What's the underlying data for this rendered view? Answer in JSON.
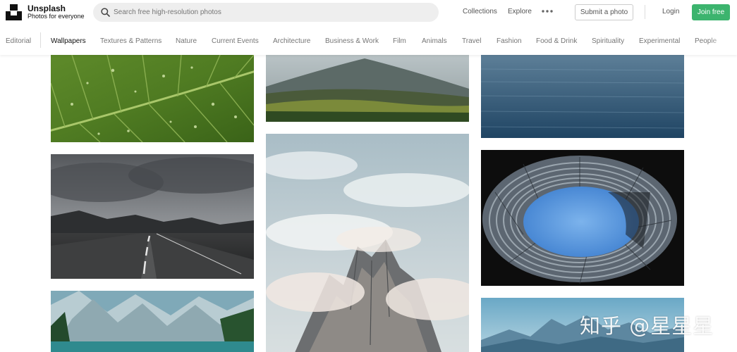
{
  "brand": {
    "name": "Unsplash",
    "tagline": "Photos for everyone"
  },
  "search": {
    "placeholder": "Search free high-resolution photos"
  },
  "nav": {
    "collections": "Collections",
    "explore": "Explore",
    "more_icon": "ellipsis-icon"
  },
  "actions": {
    "submit": "Submit a photo",
    "login": "Login",
    "join": "Join free"
  },
  "colors": {
    "accent": "#3cb46e"
  },
  "categories": [
    {
      "label": "Editorial"
    },
    {
      "label": "Wallpapers"
    },
    {
      "label": "Textures & Patterns"
    },
    {
      "label": "Nature"
    },
    {
      "label": "Current Events"
    },
    {
      "label": "Architecture"
    },
    {
      "label": "Business & Work"
    },
    {
      "label": "Film"
    },
    {
      "label": "Animals"
    },
    {
      "label": "Travel"
    },
    {
      "label": "Fashion"
    },
    {
      "label": "Food & Drink"
    },
    {
      "label": "Spirituality"
    },
    {
      "label": "Experimental"
    },
    {
      "label": "People"
    }
  ],
  "active_category": "Wallpapers",
  "photos": [
    {
      "subject": "green leaf with water droplets"
    },
    {
      "subject": "volcano mountain over green valley"
    },
    {
      "subject": "calm deep blue sea"
    },
    {
      "subject": "empty road under stormy clouds"
    },
    {
      "subject": "rocky peak rising through clouds"
    },
    {
      "subject": "looping architectural facade framing blue sky"
    },
    {
      "subject": "alpine lake with snowy mountains"
    },
    {
      "subject": "misty blue mountain range"
    }
  ],
  "watermark": "知乎 @星星星"
}
